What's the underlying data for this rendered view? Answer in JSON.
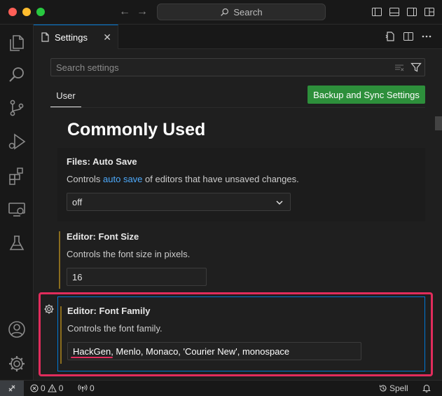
{
  "titlebar": {
    "search_label": "Search"
  },
  "tab": {
    "label": "Settings"
  },
  "search": {
    "placeholder": "Search settings"
  },
  "scope": {
    "user_label": "User"
  },
  "sync_button": {
    "label": "Backup and Sync Settings"
  },
  "section": {
    "title": "Commonly Used"
  },
  "settings": [
    {
      "title": "Files: Auto Save",
      "desc_prefix": "Controls ",
      "desc_link": "auto save",
      "desc_suffix": " of editors that have unsaved changes.",
      "value": "off"
    },
    {
      "title": "Editor: Font Size",
      "desc": "Controls the font size in pixels.",
      "value": "16"
    },
    {
      "title": "Editor: Font Family",
      "desc": "Controls the font family.",
      "value": "HackGen, Menlo, Monaco, 'Courier New', monospace"
    }
  ],
  "statusbar": {
    "errors": "0",
    "warnings": "0",
    "ports": "0",
    "spell": "Spell"
  },
  "colors": {
    "accent": "#0078d4",
    "highlight": "#e12c5c",
    "sync_button": "#2d8f3b",
    "link": "#4daafc"
  }
}
